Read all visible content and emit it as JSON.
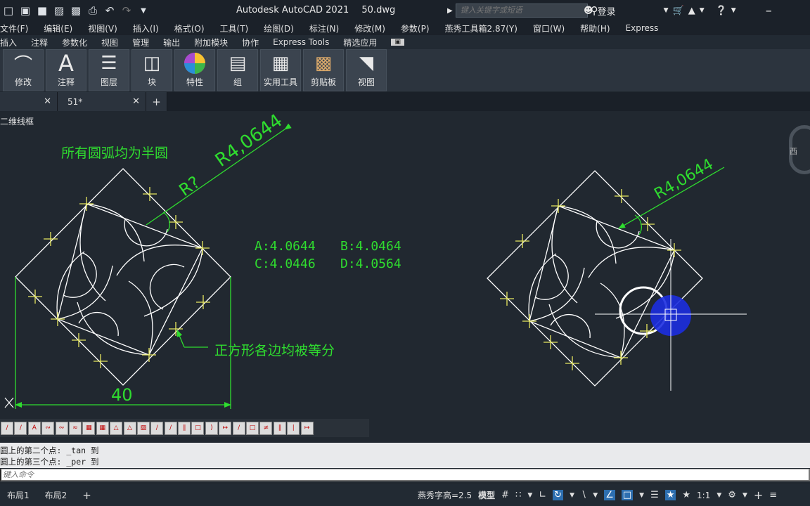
{
  "titlebar": {
    "app_title": "Autodesk AutoCAD 2021",
    "file_name": "50.dwg",
    "search_placeholder": "键入关键字或短语",
    "login_label": "登录",
    "quick_icons": [
      "□",
      "▣",
      "■",
      "▨",
      "▩",
      "⎙",
      "↶",
      "↷"
    ]
  },
  "menubar": {
    "items": [
      "文件(F)",
      "编辑(E)",
      "视图(V)",
      "插入(I)",
      "格式(O)",
      "工具(T)",
      "绘图(D)",
      "标注(N)",
      "修改(M)",
      "参数(P)",
      "燕秀工具箱2.87(Y)",
      "窗口(W)",
      "帮助(H)",
      "Express"
    ]
  },
  "ribbon_tabs": {
    "items": [
      "插入",
      "注释",
      "参数化",
      "视图",
      "管理",
      "输出",
      "附加模块",
      "协作",
      "Express Tools",
      "精选应用"
    ]
  },
  "ribbon": {
    "buttons": [
      {
        "label": "修改",
        "icon": "modify-icon"
      },
      {
        "label": "注释",
        "icon": "annotate-icon"
      },
      {
        "label": "图层",
        "icon": "layers-icon"
      },
      {
        "label": "块",
        "icon": "block-icon"
      },
      {
        "label": "特性",
        "icon": "properties-icon"
      },
      {
        "label": "组",
        "icon": "group-icon"
      },
      {
        "label": "实用工具",
        "icon": "utilities-icon"
      },
      {
        "label": "剪贴板",
        "icon": "clipboard-icon"
      },
      {
        "label": "视图",
        "icon": "view-icon"
      }
    ]
  },
  "file_tabs": {
    "tab1": "",
    "tab2": "51*"
  },
  "canvas": {
    "view_label": "二维线框",
    "viewcube_label": "西",
    "note_arcs": "所有圆弧均为半圆",
    "dim_radius_left": "R4,0644",
    "dim_radius_unknown": "R?",
    "answer_a": "A:4.0644",
    "answer_b": "B:4.0464",
    "answer_c": "C:4.0446",
    "answer_d": "D:4.0564",
    "note_sides": "正方形各边均被等分",
    "dim_width": "40",
    "dim_radius_right": "R4,0644",
    "colors": {
      "green": "#2fdc2f",
      "white": "#ffffff",
      "yellow": "#e8e860",
      "cursor_blue": "#1c2ee0"
    }
  },
  "command": {
    "history": [
      "圆上的第二个点: _tan 到",
      "圆上的第三个点: _per 到"
    ],
    "input_placeholder": "键入命令"
  },
  "statusbar": {
    "layout_tabs": [
      "布局1",
      "布局2"
    ],
    "font_height": "燕秀字高=2.5",
    "model_label": "模型",
    "scale_label": "1:1"
  }
}
